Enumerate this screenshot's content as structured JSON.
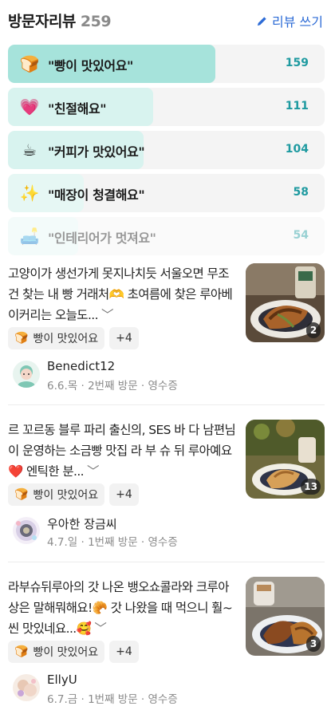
{
  "header": {
    "title": "방문자리뷰",
    "count": "259",
    "write_label": "리뷰 쓰기",
    "write_icon": "pencil-icon"
  },
  "keywords": [
    {
      "emoji": "🍞",
      "label": "\"빵이 맛있어요\"",
      "count": "159",
      "ratio": 1.0,
      "color": "#a6e3db"
    },
    {
      "emoji": "💗",
      "label": "\"친절해요\"",
      "count": "111",
      "ratio": 0.698,
      "color": "#d8f3ef"
    },
    {
      "emoji": "☕",
      "label": "\"커피가 맛있어요\"",
      "count": "104",
      "ratio": 0.654,
      "color": "#d8f3ef"
    },
    {
      "emoji": "✨",
      "label": "\"매장이 청결해요\"",
      "count": "58",
      "ratio": 0.365,
      "color": "#e6f7f4"
    },
    {
      "emoji": "🛋️",
      "label": "\"인테리어가 멋져요\"",
      "count": "54",
      "ratio": 0.34,
      "color": "#e6f7f4"
    }
  ],
  "reviews": [
    {
      "text": "고양이가 생선가게 못지나치듯 서울오면 무조건 찾는 내 빵 거래처🫶 초여름에 찾은 루아베이커리는 오늘도...",
      "more": "﹀",
      "photo_count": "2",
      "tag": "빵이 맛있어요",
      "tag_more": "+4",
      "author": "Benedict12",
      "date": "6.6.목",
      "visit": "2번째 방문",
      "proof": "영수증"
    },
    {
      "text": "르 꼬르동 블루 파리 출신의, SES 바 다 남편님이 운영하는 소금빵 맛집 라 부 슈 뒤 루아예요❤️ 엔틱한 분...",
      "more": "﹀",
      "photo_count": "13",
      "tag": "빵이 맛있어요",
      "tag_more": "+4",
      "author": "우아한 장금씨",
      "date": "4.7.일",
      "visit": "1번째 방문",
      "proof": "영수증"
    },
    {
      "text": "라부슈뒤루아의 갓 나온 뱅오쇼콜라와 크루아상은 말해뭐해요!🥐 갓 나왔을 때 먹으니 훨~씬 맛있네요...🥰",
      "more": "﹀",
      "photo_count": "3",
      "tag": "빵이 맛있어요",
      "tag_more": "+4",
      "author": "EllyU",
      "date": "6.7.금",
      "visit": "1번째 방문",
      "proof": "영수증"
    }
  ]
}
